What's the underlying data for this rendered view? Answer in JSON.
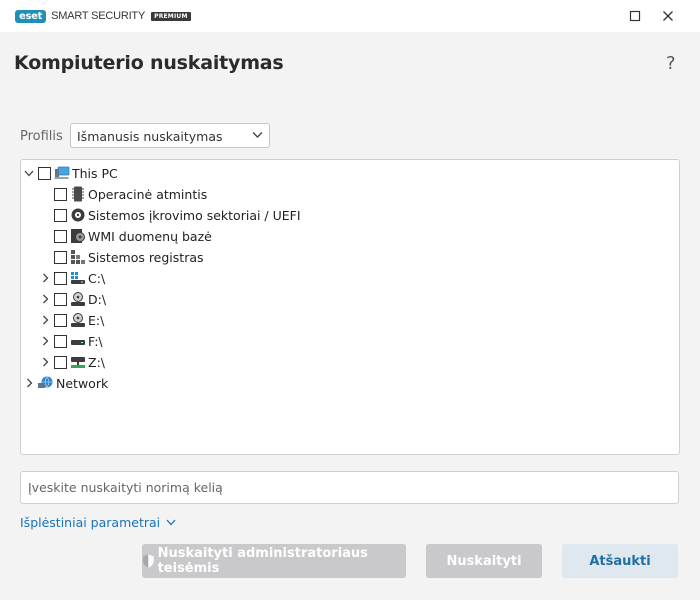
{
  "window": {
    "logo": "eset",
    "product": "SMART SECURITY",
    "edition": "PREMIUM",
    "minimize_icon": "minimize-icon",
    "close_icon": "close-icon"
  },
  "page": {
    "title": "Kompiuterio nuskaitymas",
    "help": "?"
  },
  "profile": {
    "label": "Profilis",
    "selected": "Išmanusis nuskaitymas"
  },
  "tree": {
    "root": "This PC",
    "items": [
      "Operacinė atmintis",
      "Sistemos įkrovimo sektoriai / UEFI",
      "WMI duomenų bazė",
      "Sistemos registras"
    ],
    "drives": [
      "C:\\",
      "D:\\",
      "E:\\",
      "F:\\",
      "Z:\\"
    ],
    "network": "Network"
  },
  "path": {
    "placeholder": "Įveskite nuskaityti norimą kelią",
    "value": ""
  },
  "advanced": {
    "label": "Išplėstiniai parametrai"
  },
  "buttons": {
    "admin_scan": "Nuskaityti administratoriaus teisėmis",
    "scan": "Nuskaityti",
    "cancel": "Atšaukti"
  },
  "colors": {
    "accent": "#1a73b5",
    "logo": "#1f8fb7",
    "disabled_button": "#c9c9cb",
    "cancel_button": "#dfe8ef"
  }
}
